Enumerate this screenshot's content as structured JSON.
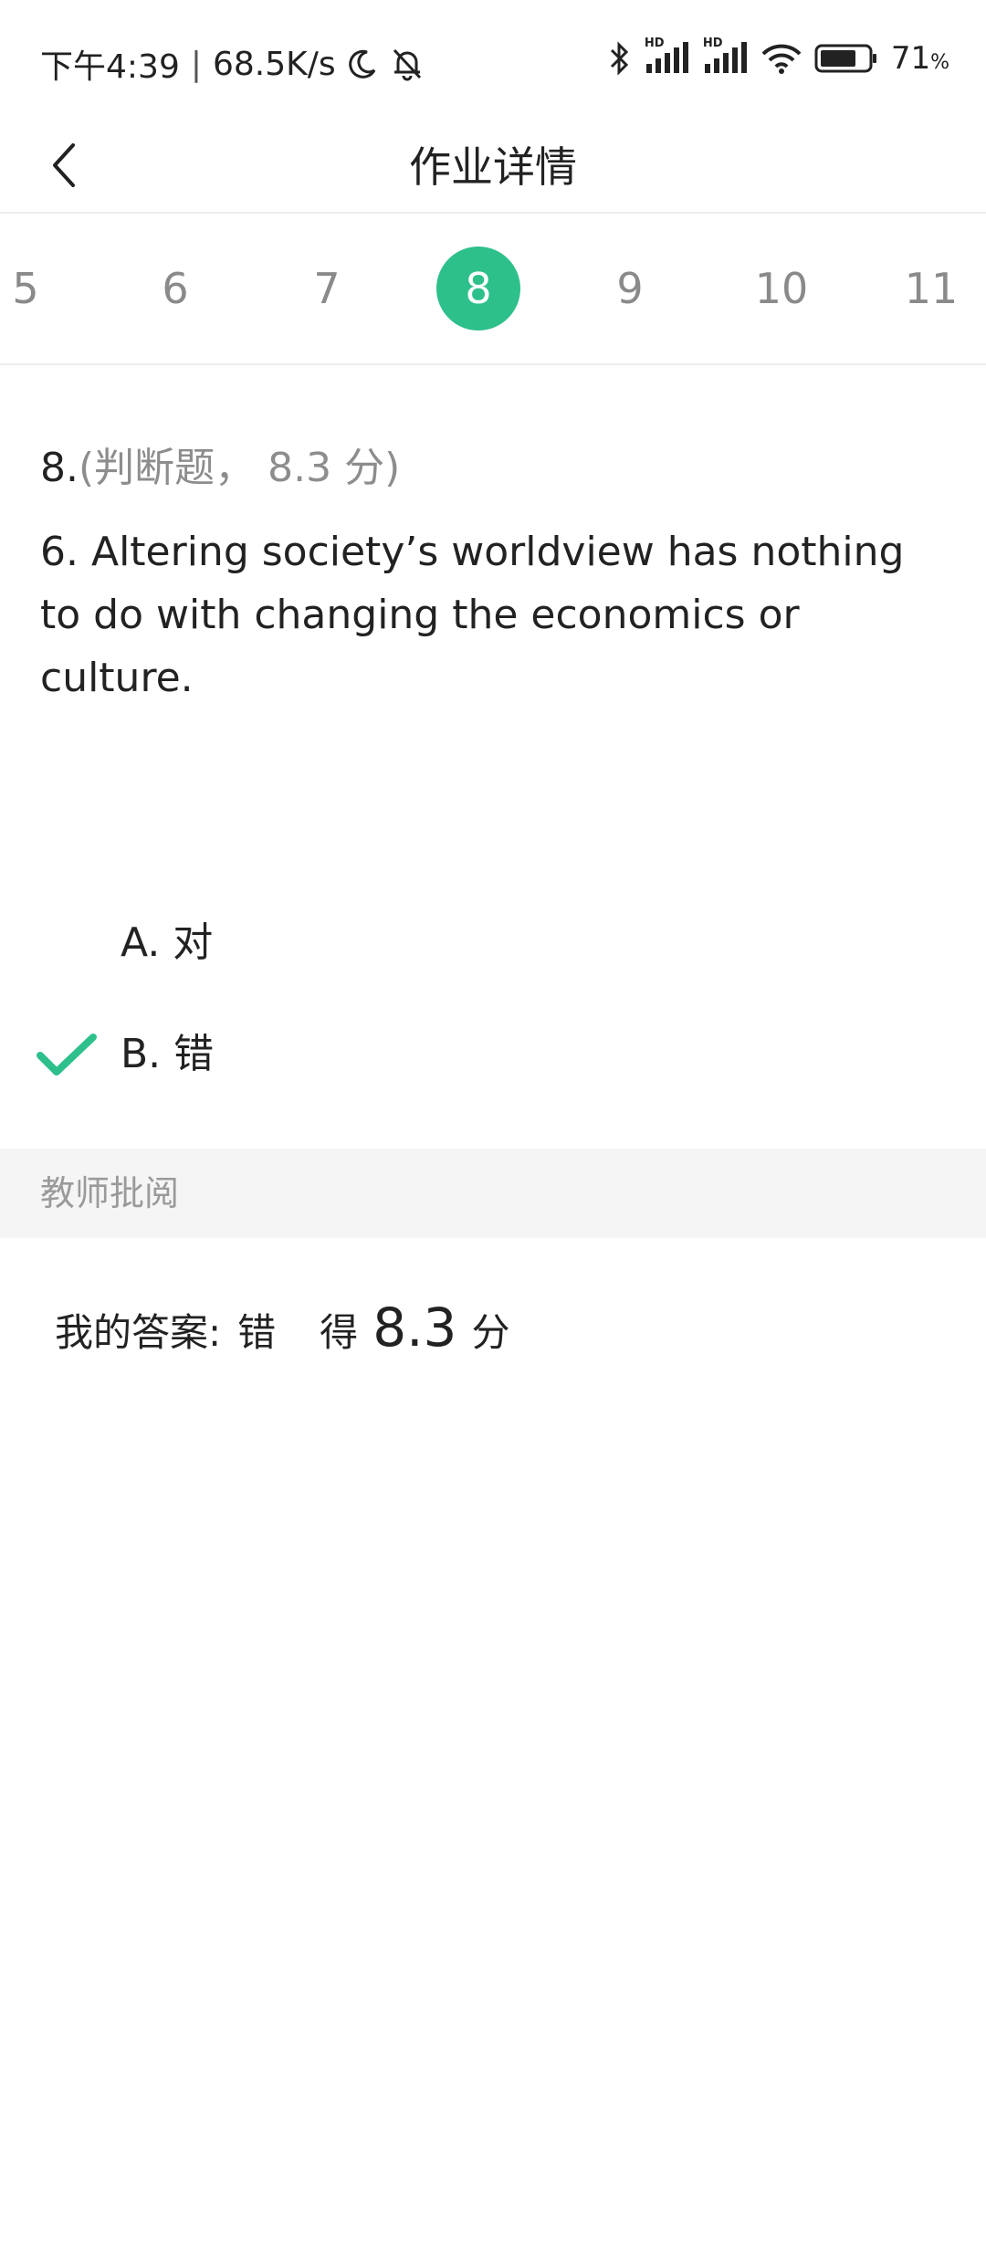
{
  "status_bar": {
    "time": "下午4:39",
    "separator": "|",
    "net_speed": "68.5K/s",
    "battery_percent": "71",
    "battery_unit": "%",
    "sim1_label": "HD",
    "sim2_label": "HD",
    "icons": [
      "moon-icon",
      "bell-off-icon",
      "bluetooth-icon",
      "signal-icon",
      "signal-icon",
      "wifi-icon",
      "battery-icon"
    ]
  },
  "header": {
    "title": "作业详情",
    "back_icon": "chevron-left-icon"
  },
  "question_tabs": {
    "items": [
      "5",
      "6",
      "7",
      "8",
      "9",
      "10",
      "11"
    ],
    "active": "8",
    "active_color": "#2ec08b"
  },
  "question": {
    "number": "8.",
    "type_label": "(判断题， 8.3 分)",
    "text": "6. Altering society’s worldview has nothing to do with changing the economics or culture."
  },
  "options": [
    {
      "label": "A. 对",
      "selected": false
    },
    {
      "label": "B. 错",
      "selected": true
    }
  ],
  "review": {
    "title": "教师批阅",
    "my_answer_label": "我的答案:",
    "my_answer_value": "错",
    "score_prefix": "得",
    "score": "8.3",
    "score_unit": "分"
  },
  "colors": {
    "accent": "#2ec08b",
    "muted_text": "#8d8d8d",
    "section_bg": "#f5f5f5"
  }
}
